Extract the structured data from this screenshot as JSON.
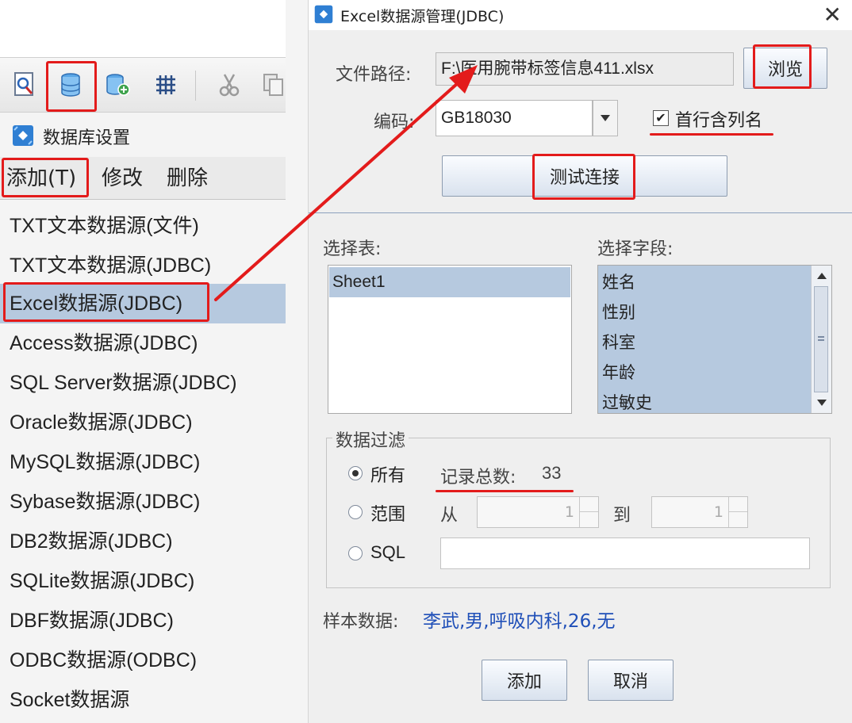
{
  "left_panel": {
    "toolbar_icons": [
      "query-icon",
      "database-icon",
      "database-add-icon",
      "grid-icon",
      "cut-icon",
      "copy-icon"
    ],
    "title": "数据库设置",
    "menu": {
      "add": "添加(T)",
      "edit": "修改",
      "delete": "删除"
    },
    "data_sources": [
      "TXT文本数据源(文件)",
      "TXT文本数据源(JDBC)",
      "Excel数据源(JDBC)",
      "Access数据源(JDBC)",
      "SQL Server数据源(JDBC)",
      "Oracle数据源(JDBC)",
      "MySQL数据源(JDBC)",
      "Sybase数据源(JDBC)",
      "DB2数据源(JDBC)",
      "SQLite数据源(JDBC)",
      "DBF数据源(JDBC)",
      "ODBC数据源(ODBC)",
      "Socket数据源"
    ],
    "selected_index": 2
  },
  "dialog": {
    "title": "Excel数据源管理(JDBC)",
    "file_path_label": "文件路径:",
    "file_path_value": "F:\\医用腕带标签信息411.xlsx",
    "browse_label": "浏览",
    "encoding_label": "编码:",
    "encoding_value": "GB18030",
    "first_row_header_label": "首行含列名",
    "first_row_header_checked": true,
    "test_connection_label": "测试连接",
    "select_table_label": "选择表:",
    "tables": [
      "Sheet1"
    ],
    "selected_table": "Sheet1",
    "select_fields_label": "选择字段:",
    "fields": [
      "姓名",
      "性别",
      "科室",
      "年龄",
      "过敏史"
    ],
    "filter_group_label": "数据过滤",
    "filter_all_label": "所有",
    "record_total_label": "记录总数:",
    "record_total_value": "33",
    "filter_range_label": "范围",
    "range_from_label": "从",
    "range_from_value": "1",
    "range_to_label": "到",
    "range_to_value": "1",
    "filter_sql_label": "SQL",
    "sql_value": "",
    "selected_filter": "所有",
    "sample_label": "样本数据:",
    "sample_value": "李武,男,呼吸内科,26,无",
    "add_label": "添加",
    "cancel_label": "取消"
  },
  "colors": {
    "annotation": "#e31b1b",
    "selection": "#b6c9df",
    "sample_text": "#1f4fb8"
  }
}
